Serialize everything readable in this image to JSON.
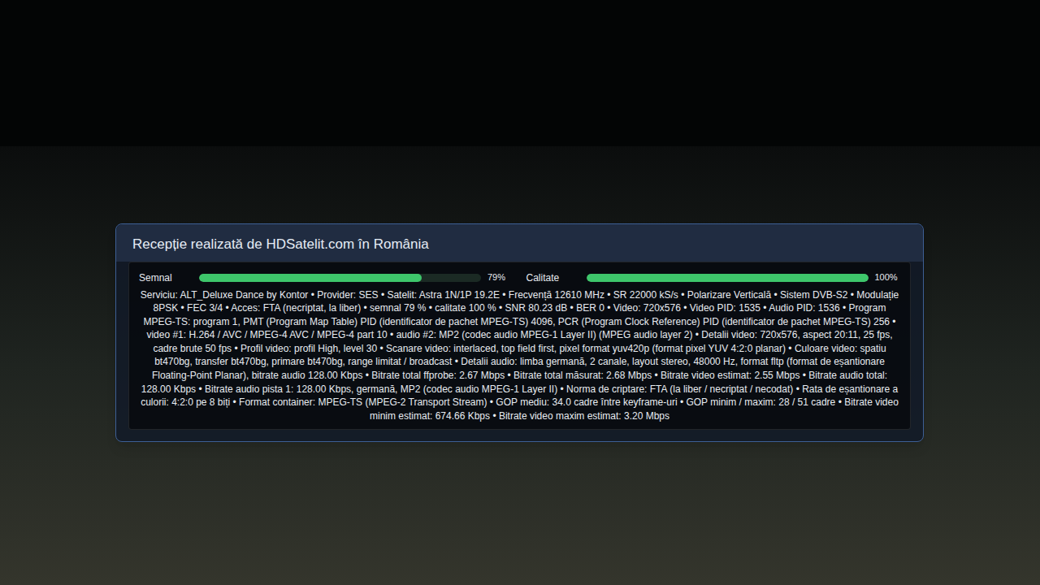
{
  "panel": {
    "title": "Recepție realizată de HDSatelit.com în România"
  },
  "meters": [
    {
      "label": "Semnal",
      "level": 0.79,
      "reading": "79%"
    },
    {
      "label": "Calitate",
      "level": 1.0,
      "reading": "100%"
    }
  ],
  "details": {
    "separator": "•",
    "items": [
      "Serviciu: ALT_Deluxe Dance by Kontor",
      "Provider: SES",
      "Satelit: Astra 1N/1P 19.2E",
      "Frecvență 12610 MHz",
      "SR 22000 kS/s",
      "Polarizare Verticală",
      "Sistem DVB-S2",
      "Modulație 8PSK",
      "FEC 3/4",
      "Acces: FTA (necriptat, la liber)",
      "semnal 79 %",
      "calitate 100 %",
      "SNR 80.23 dB",
      "BER 0",
      "Video: 720x576",
      "Video PID: 1535",
      "Audio PID: 1536",
      "Program MPEG-TS: program 1, PMT (Program Map Table) PID (identificator de pachet MPEG-TS) 4096, PCR (Program Clock Reference) PID (identificator de pachet MPEG-TS) 256",
      "video #1: H.264 / AVC / MPEG-4 AVC / MPEG-4 part 10",
      "audio #2: MP2 (codec audio MPEG-1 Layer II) (MPEG audio layer 2)",
      "Detalii video: 720x576, aspect 20:11, 25 fps, cadre brute 50 fps",
      "Profil video: profil High, level 30",
      "Scanare video: interlaced, top field first, pixel format yuv420p (format pixel YUV 4:2:0 planar)",
      "Culoare video: spatiu bt470bg, transfer bt470bg, primare bt470bg, range limitat / broadcast",
      "Detalii audio: limba germană, 2 canale, layout stereo, 48000 Hz, format fltp (format de eșantionare Floating-Point Planar), bitrate audio 128.00 Kbps",
      "Bitrate total ffprobe: 2.67 Mbps",
      "Bitrate total măsurat: 2.68 Mbps",
      "Bitrate video estimat: 2.55 Mbps",
      "Bitrate audio total: 128.00 Kbps",
      "Bitrate audio pista 1: 128.00 Kbps, germană, MP2 (codec audio MPEG-1 Layer II)",
      "Norma de criptare: FTA (la liber / necriptat / necodat)",
      "Rata de eșantionare a culorii: 4:2:0 pe 8 biți",
      "Format container: MPEG-TS (MPEG-2 Transport Stream)",
      "GOP mediu: 34.0 cadre între keyframe-uri",
      "GOP minim / maxim: 28 / 51 cadre",
      "Bitrate video minim estimat: 674.66 Kbps",
      "Bitrate video maxim estimat: 3.20 Mbps"
    ]
  }
}
